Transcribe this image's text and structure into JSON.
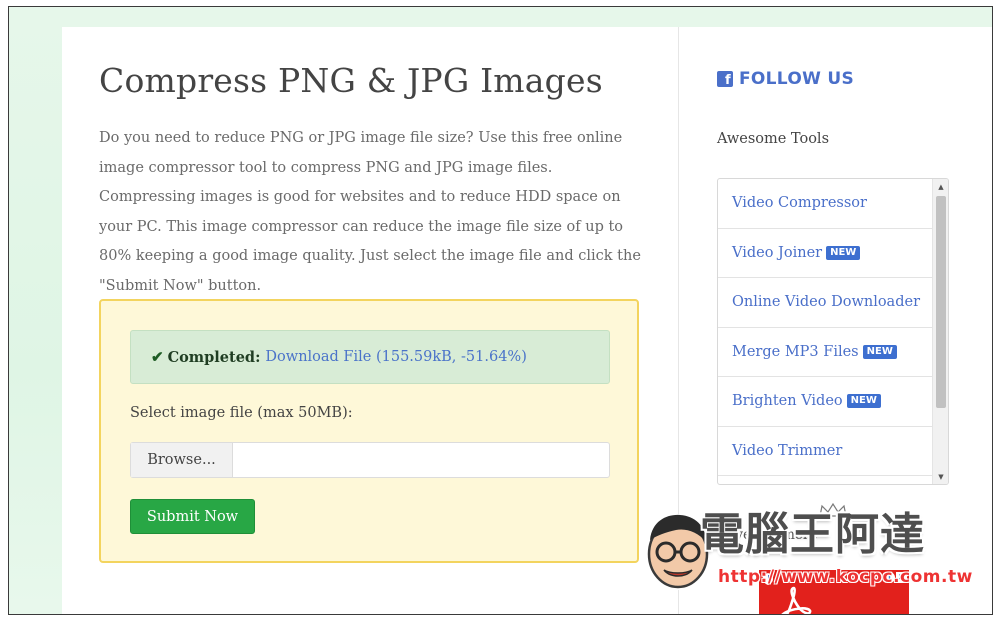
{
  "main": {
    "title": "Compress PNG & JPG Images",
    "intro": "Do you need to reduce PNG or JPG image file size? Use this free online image compressor tool to compress PNG and JPG image files. Compressing images is good for websites and to reduce HDD space on your PC. This image compressor can reduce the image file size of up to 80% keeping a good image quality. Just select the image file and click the \"Submit Now\" button.",
    "alert": {
      "icon": "check-icon",
      "status": "Completed:",
      "link_text": "Download File (155.59kB, -51.64%)",
      "color": "#d8ecd6"
    },
    "file_label": "Select image file (max 50MB):",
    "browse_label": "Browse...",
    "file_value": "",
    "submit_label": "Submit Now",
    "submit_color": "#28a745"
  },
  "sidebar": {
    "follow_icon": "facebook-icon",
    "follow_label": "FOLLOW US",
    "tools_heading": "Awesome Tools",
    "tools": [
      {
        "label": "Video Compressor",
        "badge": ""
      },
      {
        "label": "Video Joiner",
        "badge": "NEW"
      },
      {
        "label": "Online Video Downloader",
        "badge": ""
      },
      {
        "label": "Merge MP3 Files",
        "badge": "NEW"
      },
      {
        "label": "Brighten Video",
        "badge": "NEW"
      },
      {
        "label": "Video Trimmer",
        "badge": ""
      }
    ],
    "ad_label": "Advertisement",
    "ad_icons": [
      "adobe-pdf-icon",
      "ad-info-icon",
      "ad-close-icon"
    ]
  },
  "watermark": {
    "brand": "電腦王阿達",
    "url": "http://www.kocpc.com.tw",
    "icons": [
      "mascot-face-icon",
      "crown-icon"
    ]
  },
  "colors": {
    "link": "#4a73c9",
    "badge": "#3d6fd0",
    "tool_box_bg": "#fef8d8",
    "tool_box_border": "#f3d45e",
    "page_bg": "#e6f7ea",
    "ad_bg": "#e2211c"
  }
}
